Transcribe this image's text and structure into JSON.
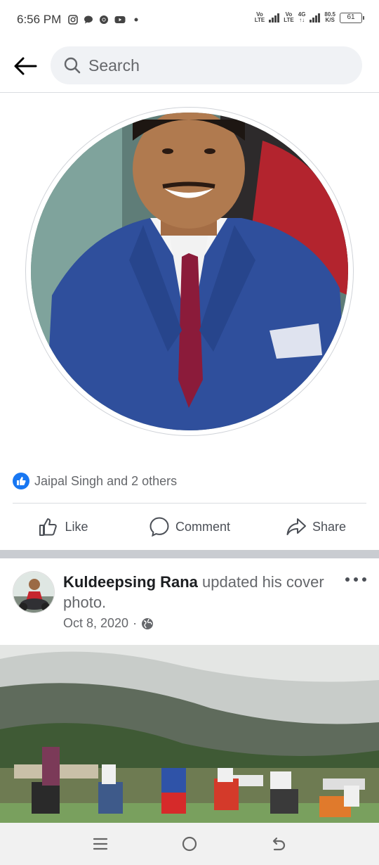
{
  "status_bar": {
    "time": "6:56 PM",
    "net1_top": "Vo",
    "net1_bottom": "LTE",
    "net2_top": "Vo",
    "net2_bottom": "LTE",
    "net3_top": "4G",
    "net3_bottom": "↑↓",
    "speed_top": "80.5",
    "speed_bottom": "K/S",
    "battery": "61",
    "icons": [
      "instagram-icon",
      "chat-icon",
      "chrome-icon",
      "youtube-icon",
      "dot-icon"
    ]
  },
  "search": {
    "placeholder": "Search"
  },
  "reactions": {
    "text": "Jaipal Singh and 2 others"
  },
  "actions": {
    "like": "Like",
    "comment": "Comment",
    "share": "Share"
  },
  "post": {
    "author": "Kuldeepsing Rana",
    "action": "updated his cover photo.",
    "date": "Oct 8, 2020",
    "separator": "·"
  },
  "colors": {
    "accent": "#1877f2",
    "text_secondary": "#65676b",
    "divider": "#dadde1",
    "section_gap": "#c9ccd1"
  }
}
